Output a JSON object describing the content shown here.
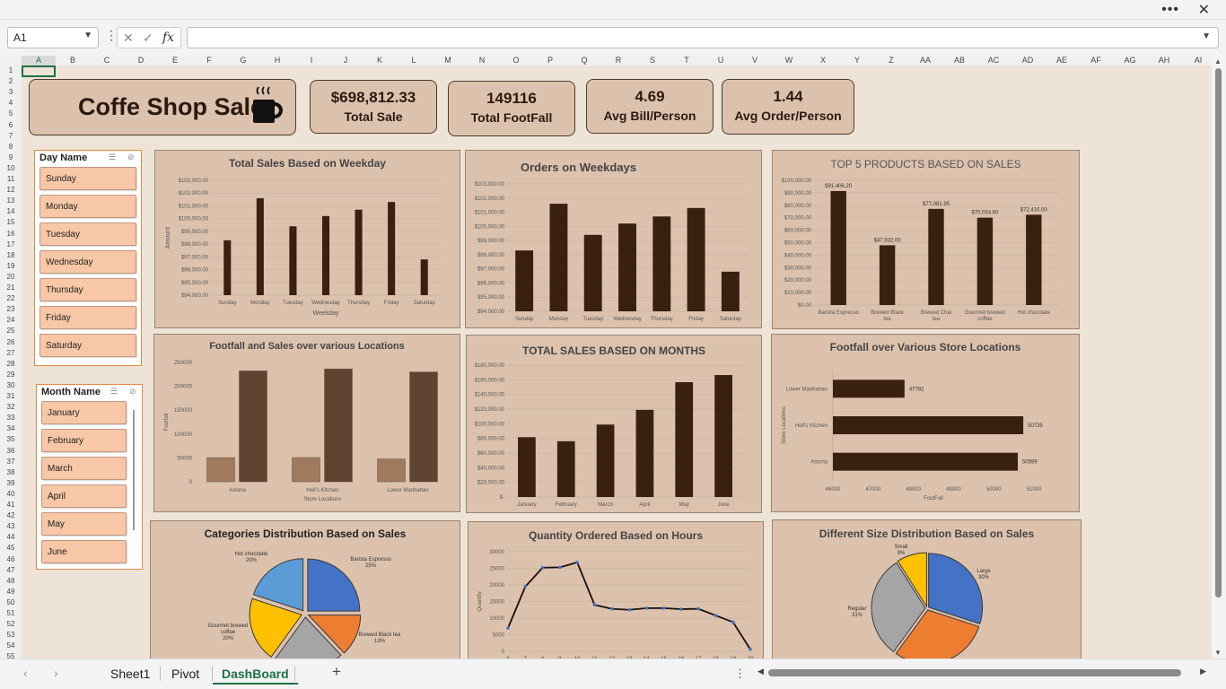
{
  "namebox": "A1",
  "fx": "fx",
  "columns": [
    "A",
    "B",
    "C",
    "D",
    "E",
    "F",
    "G",
    "H",
    "I",
    "J",
    "K",
    "L",
    "M",
    "N",
    "O",
    "P",
    "Q",
    "R",
    "S",
    "T",
    "U",
    "V",
    "W",
    "X",
    "Y",
    "Z",
    "AA",
    "AB",
    "AC",
    "AD",
    "AE",
    "AF",
    "AG",
    "AH",
    "AI"
  ],
  "rows": [
    "1",
    "2",
    "3",
    "4",
    "5",
    "6",
    "7",
    "8",
    "9",
    "10",
    "11",
    "12",
    "13",
    "14",
    "15",
    "16",
    "17",
    "18",
    "19",
    "20",
    "21",
    "22",
    "23",
    "24",
    "25",
    "26",
    "27",
    "28",
    "29",
    "30",
    "31",
    "32",
    "33",
    "34",
    "35",
    "36",
    "37",
    "38",
    "39",
    "40",
    "41",
    "42",
    "43",
    "44",
    "45",
    "46",
    "47",
    "48",
    "49",
    "50",
    "51",
    "52",
    "53",
    "54",
    "55"
  ],
  "title": "Coffe Shop Sale",
  "kpis": [
    {
      "value": "$698,812.33",
      "label": "Total Sale"
    },
    {
      "value": "149116",
      "label": "Total FootFall"
    },
    {
      "value": "4.69",
      "label": "Avg Bill/Person"
    },
    {
      "value": "1.44",
      "label": "Avg Order/Person"
    }
  ],
  "day_slicer": {
    "header": "Day Name",
    "items": [
      "Sunday",
      "Monday",
      "Tuesday",
      "Wednesday",
      "Thursday",
      "Friday",
      "Saturday"
    ]
  },
  "month_slicer": {
    "header": "Month Name",
    "items": [
      "January",
      "February",
      "March",
      "April",
      "May",
      "June"
    ]
  },
  "sheet_tabs": [
    "Sheet1",
    "Pivot",
    "DashBoard"
  ],
  "active_tab": "DashBoard",
  "colors": {
    "bar": "#3a2010",
    "bar_light": "#a07a5e",
    "bar_mid": "#5e4330",
    "pie_blue": "#4472c4",
    "pie_orange": "#ed7d31",
    "pie_gray": "#a5a5a5",
    "pie_yellow": "#ffc000",
    "pie_lightblue": "#5b9bd5"
  },
  "chart_data": [
    {
      "id": "c1",
      "type": "bar",
      "title": "Total Sales Based on Weekday",
      "xlabel": "Weekday",
      "ylabel": "Amount",
      "categories": [
        "Sunday",
        "Monday",
        "Tuesday",
        "Wednesday",
        "Thursday",
        "Friday",
        "Saturday"
      ],
      "values": [
        98300,
        101600,
        99400,
        100200,
        100700,
        101300,
        96800
      ],
      "ylim": [
        94000,
        103000
      ],
      "yticks": [
        "$94,000.00",
        "$95,000.00",
        "$96,000.00",
        "$97,000.00",
        "$98,000.00",
        "$99,000.00",
        "$100,000.00",
        "$101,000.00",
        "$102,000.00",
        "$103,000.00"
      ]
    },
    {
      "id": "c2",
      "type": "bar",
      "title": "Orders on Weekdays",
      "xlabel": "",
      "ylabel": "",
      "categories": [
        "Sunday",
        "Monday",
        "Tuesday",
        "Wednesday",
        "Thursday",
        "Friday",
        "Saturday"
      ],
      "values": [
        98300,
        101600,
        99400,
        100200,
        100700,
        101300,
        96800
      ],
      "ylim": [
        94000,
        103000
      ],
      "yticks": [
        "$94,000.00",
        "$95,000.00",
        "$96,000.00",
        "$97,000.00",
        "$98,000.00",
        "$99,000.00",
        "$100,000.00",
        "$101,000.00",
        "$102,000.00",
        "$103,000.00"
      ]
    },
    {
      "id": "c3",
      "type": "bar",
      "title": "TOP 5 PRODUCTS BASED ON SALES",
      "xlabel": "",
      "ylabel": "",
      "categories": [
        "Barista Espresso",
        "Brewed Black tea",
        "Brewed Chai tea",
        "Gourmet brewed coffee",
        "Hot chocolate"
      ],
      "values": [
        91406.2,
        47932.0,
        77081.95,
        70034.6,
        72416.0
      ],
      "labels": [
        "$91,406.20",
        "$47,932.00",
        "$77,081.95",
        "$70,034.60",
        "$72,416.00"
      ],
      "ylim": [
        0,
        100000
      ],
      "yticks": [
        "$0.00",
        "$10,000.00",
        "$20,000.00",
        "$30,000.00",
        "$40,000.00",
        "$50,000.00",
        "$60,000.00",
        "$70,000.00",
        "$80,000.00",
        "$90,000.00",
        "$100,000.00"
      ]
    },
    {
      "id": "c4",
      "type": "bar",
      "title": "Footfall and Sales over various Locations",
      "xlabel": "Store Locations",
      "ylabel": "Footfall",
      "categories": [
        "Astoria",
        "Hell's Kitchen",
        "Lower Manhattan"
      ],
      "series": [
        {
          "values": [
            50599,
            50735,
            47782
          ]
        },
        {
          "values": [
            232244,
            236511,
            230057
          ]
        }
      ],
      "ylim": [
        0,
        250000
      ],
      "yticks": [
        "0",
        "50000",
        "100000",
        "150000",
        "200000",
        "250000"
      ]
    },
    {
      "id": "c5",
      "type": "bar",
      "title": "TOTAL SALES BASED ON MONTHS",
      "xlabel": "",
      "ylabel": "",
      "categories": [
        "January",
        "February",
        "March",
        "April",
        "May",
        "June"
      ],
      "values": [
        81678,
        76145,
        98835,
        118941,
        156728,
        166486
      ],
      "ylim": [
        0,
        180000
      ],
      "yticks": [
        "$-",
        "$20,000.00",
        "$40,000.00",
        "$60,000.00",
        "$80,000.00",
        "$100,000.00",
        "$120,000.00",
        "$140,000.00",
        "$160,000.00",
        "$180,000.00"
      ]
    },
    {
      "id": "c6",
      "type": "bar",
      "orientation": "horizontal",
      "title": "Footfall over Various Store Locations",
      "xlabel": "FootFall",
      "ylabel": "Store Locations",
      "categories": [
        "Lower Manhattan",
        "Hell's Kitchen",
        "Astoria"
      ],
      "values": [
        47782,
        50735,
        50599
      ],
      "labels": [
        "47782",
        "50735",
        "50599"
      ],
      "xlim": [
        46000,
        51000
      ],
      "xticks": [
        "46000",
        "47000",
        "48000",
        "49000",
        "50000",
        "51000"
      ]
    },
    {
      "id": "c7",
      "type": "pie",
      "title": "Categories  Distribution Based on Sales",
      "slices": [
        {
          "name": "Barista Espresso",
          "value": 25,
          "label": "25%"
        },
        {
          "name": "Brewed Black tea",
          "value": 13,
          "label": "13%"
        },
        {
          "name": "",
          "value": 22,
          "label": ""
        },
        {
          "name": "Gourmet brewed coffee",
          "value": 20,
          "label": "20%"
        },
        {
          "name": "Hot chocolate",
          "value": 20,
          "label": "20%"
        }
      ]
    },
    {
      "id": "c8",
      "type": "line",
      "title": "Quantity  Ordered Based on Hours",
      "xlabel": "",
      "ylabel": "Quantity",
      "x": [
        "6",
        "7",
        "8",
        "9",
        "10",
        "11",
        "12",
        "13",
        "14",
        "15",
        "16",
        "17",
        "18",
        "19",
        "20"
      ],
      "values": [
        7000,
        19500,
        25200,
        25300,
        26800,
        14000,
        12800,
        12500,
        13000,
        13000,
        12700,
        12800,
        10800,
        8800,
        600
      ],
      "ylim": [
        0,
        30000
      ],
      "yticks": [
        "0",
        "5000",
        "10000",
        "15000",
        "20000",
        "25000",
        "30000"
      ]
    },
    {
      "id": "c9",
      "type": "pie",
      "title": "Different Size Distribution Based on Sales",
      "slices": [
        {
          "name": "Large",
          "value": 30,
          "label": "30%"
        },
        {
          "name": "",
          "value": 30,
          "label": ""
        },
        {
          "name": "Regular",
          "value": 31,
          "label": "31%"
        },
        {
          "name": "Small",
          "value": 9,
          "label": "9%"
        }
      ]
    }
  ]
}
